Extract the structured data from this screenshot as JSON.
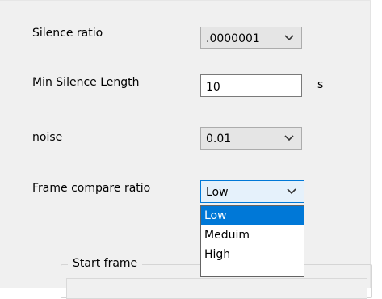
{
  "silence_ratio": {
    "label": "Silence ratio",
    "value": ".0000001"
  },
  "min_silence_length": {
    "label": "Min Silence Length",
    "value": "10",
    "unit": "s"
  },
  "noise": {
    "label": "noise",
    "value": "0.01"
  },
  "frame_compare_ratio": {
    "label": "Frame compare ratio",
    "value": "Low",
    "options": [
      "Low",
      "Meduim",
      "High"
    ],
    "highlighted": "Low"
  },
  "start_frame": {
    "label": "Start frame"
  },
  "colors": {
    "accent": "#0078d7",
    "panel": "#f0f0f0"
  },
  "icons": {
    "dropdown": "chevron-down-icon"
  }
}
